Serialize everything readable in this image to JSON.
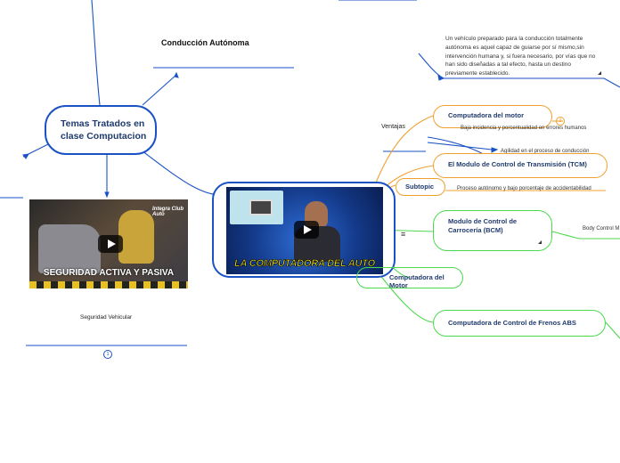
{
  "central": {
    "title": "Temas Tratados en clase Computacion"
  },
  "branches": {
    "conduccion": "Conducción Autónoma",
    "conduccion_note": "Un vehículo preparado para la conducción totalmente autónoma es aquel capaz de guiarse por sí mismo,sin intervención humana y, si fuera necesario, por vías que no han sido diseñadas a tal efecto, hasta un destino previamente establecido. ",
    "ventajas": "Ventajas",
    "computadora_motor": "Computadora del motor",
    "badge_count": "3",
    "baja_incidencia": "Baja incidencia y porcentualidad en errores humanos",
    "agilidad": "Agilidad en el proceso de conducción",
    "tcm": "El Modulo de Control de Transmisión (TCM)",
    "subtopic": "Subtopic",
    "proceso": "Proceso autónomo y bajo porcentaje de accidentabilidad",
    "bcm": "Modulo de Control de Carrocería (BCM)",
    "body_control": "Body Control M",
    "computadora_motor2": "Computadora del  Motor",
    "abs": "Computadora de Control de Frenos ABS",
    "seguridad": "Seguridad Vehicular",
    "seguridad_badge": "1"
  },
  "videos": {
    "left_caption": "SEGURIDAD ACTIVA Y PASIVA",
    "left_logo": "Integra Club Auto",
    "center_caption": "LA COMPUTADORA DEL AUTO"
  },
  "colors": {
    "blue": "#1a52c4",
    "orange": "#f0a030",
    "green": "#4cd94c",
    "navy": "#1f3a6e"
  }
}
